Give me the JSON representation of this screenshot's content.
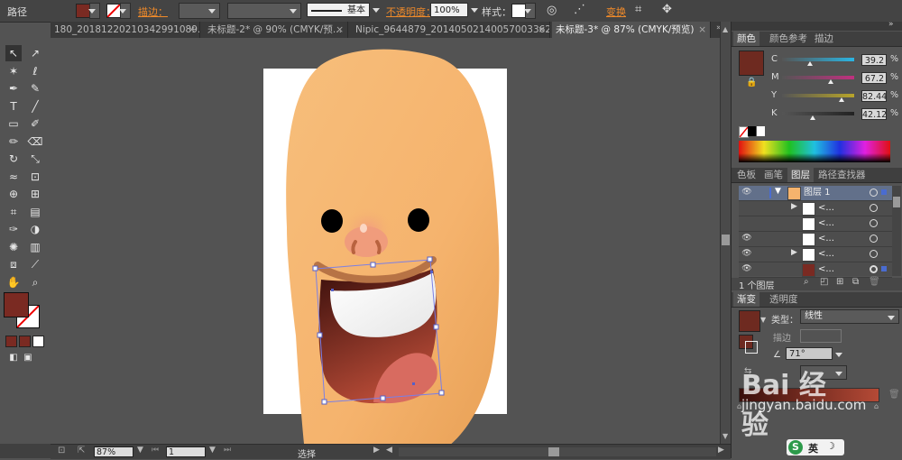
{
  "control_bar": {
    "object_type": "路径",
    "stroke_label": "描边：",
    "stroke_profile": "基本",
    "opacity_label": "不透明度：",
    "opacity_value": "100%",
    "style_label": "样式：",
    "transform_label": "变换",
    "fill_color": "#7a2a22"
  },
  "tabs": [
    {
      "label": "180_20181220210342991089.ai*",
      "active": false
    },
    {
      "label": "未标题-2* @ 90% (CMYK/预...",
      "active": false
    },
    {
      "label": "Nipic_9644879_20140502140057003362.ai*",
      "active": false
    },
    {
      "label": "未标题-3* @ 87% (CMYK/预览)",
      "active": true
    }
  ],
  "tools": [
    "selection-tool",
    "direct-selection-tool",
    "magic-wand-tool",
    "lasso-tool",
    "pen-tool",
    "curvature-tool",
    "type-tool",
    "line-tool",
    "rectangle-tool",
    "paintbrush-tool",
    "pencil-tool",
    "eraser-tool",
    "rotate-tool",
    "scale-tool",
    "warp-tool",
    "free-transform-tool",
    "shape-builder-tool",
    "perspective-tool",
    "mesh-tool",
    "gradient-tool",
    "eyedropper-tool",
    "blend-tool",
    "symbol-sprayer-tool",
    "column-graph-tool",
    "artboard-tool",
    "slice-tool",
    "hand-tool",
    "zoom-tool"
  ],
  "status_bar": {
    "zoom": "87%",
    "page": "1",
    "mode": "选择"
  },
  "color_panel": {
    "tabs": [
      "颜色",
      "颜色参考",
      "描边"
    ],
    "swatch": "#6e2a20",
    "channels": [
      {
        "name": "C",
        "value": "39.2",
        "unit": "%",
        "color": "#2bb5e3",
        "level": 0.392
      },
      {
        "name": "M",
        "value": "67.2",
        "unit": "%",
        "color": "#c0307f",
        "level": 0.672
      },
      {
        "name": "Y",
        "value": "82.44",
        "unit": "%",
        "color": "#b8a52a",
        "level": 0.824
      },
      {
        "name": "K",
        "value": "42.12",
        "unit": "%",
        "color": "#222222",
        "level": 0.421
      }
    ]
  },
  "layers_panel": {
    "tabs": [
      "色板",
      "画笔",
      "图层",
      "路径查找器"
    ],
    "layer_name": "图层 1",
    "sublayer_label": "<...",
    "count_label": "1 个图层"
  },
  "gradient_panel": {
    "tabs": [
      "渐变",
      "透明度"
    ],
    "type_label": "类型：",
    "type_value": "线性",
    "stroke_label": "描边",
    "angle": "71°",
    "gradient_start": "#3a0f0c",
    "gradient_end": "#b54a36"
  },
  "watermark": {
    "text": "Bai 经验",
    "url": "jingyan.baidu.com"
  },
  "ime_badge": "英"
}
